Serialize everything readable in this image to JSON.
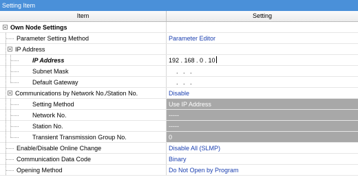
{
  "window": {
    "title": "Setting Item"
  },
  "header": {
    "item": "Item",
    "setting": "Setting"
  },
  "rows": [
    {
      "label": "Own Node Settings",
      "value": ""
    },
    {
      "label": "Parameter Setting Method",
      "value": "Parameter Editor"
    },
    {
      "label": "IP Address",
      "value": ""
    },
    {
      "label": "IP Address",
      "value": "192 . 168 . 0 . 10"
    },
    {
      "label": "Subnet Mask",
      "value": ". . ."
    },
    {
      "label": "Default Gateway",
      "value": ". . ."
    },
    {
      "label": "Communications by Network No./Station No.",
      "value": "Disable"
    },
    {
      "label": "Setting Method",
      "value": "Use IP Address"
    },
    {
      "label": "Network No.",
      "value": "-----"
    },
    {
      "label": "Station No.",
      "value": "-----"
    },
    {
      "label": "Transient Transmission Group No.",
      "value": "0"
    },
    {
      "label": "Enable/Disable Online Change",
      "value": "Disable All (SLMP)"
    },
    {
      "label": "Communication Data Code",
      "value": "Binary"
    },
    {
      "label": "Opening Method",
      "value": "Do Not Open by Program"
    }
  ],
  "colors": {
    "accent": "#4a90d9",
    "value_text": "#1a3fb0",
    "disabled_bg": "#a8a8a8"
  }
}
